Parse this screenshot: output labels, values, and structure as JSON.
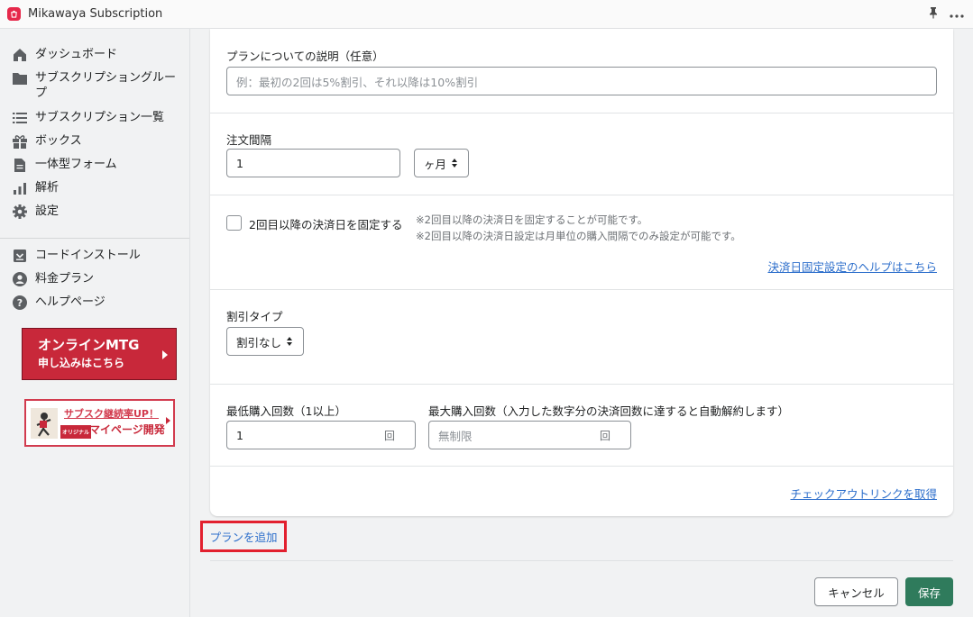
{
  "app": {
    "title": "Mikawaya Subscription"
  },
  "sidebar": {
    "items": [
      {
        "label": "ダッシュボード",
        "icon": "home-icon"
      },
      {
        "label": "サブスクリプショングループ",
        "icon": "folder-icon"
      },
      {
        "label": "サブスクリプション一覧",
        "icon": "list-icon"
      },
      {
        "label": "ボックス",
        "icon": "gift-icon"
      },
      {
        "label": "一体型フォーム",
        "icon": "document-icon"
      },
      {
        "label": "解析",
        "icon": "bar-chart-icon"
      },
      {
        "label": "設定",
        "icon": "gear-icon"
      }
    ],
    "items2": [
      {
        "label": "コードインストール",
        "icon": "code-install-icon"
      },
      {
        "label": "料金プラン",
        "icon": "user-icon"
      },
      {
        "label": "ヘルプページ",
        "icon": "help-icon"
      }
    ],
    "banner1": {
      "title": "オンラインMTG",
      "subtitle": "申し込みはこちら"
    },
    "banner2": {
      "title": "サブスク継続率UP！",
      "tag": "オリジナル",
      "subtitle": "マイページ開発"
    }
  },
  "form": {
    "description": {
      "label": "プランについての説明（任意）",
      "placeholder": "例：最初の2回は5%割引、それ以降は10%割引"
    },
    "interval": {
      "label": "注文間隔",
      "value": "1",
      "unit": "ヶ月"
    },
    "fixed_date": {
      "label": "2回目以降の決済日を固定する",
      "note1": "※2回目以降の決済日を固定することが可能です。",
      "note2": "※2回目以降の決済日設定は月単位の購入間隔でのみ設定が可能です。",
      "help_link": "決済日固定設定のヘルプはこちら"
    },
    "discount": {
      "label": "割引タイプ",
      "value": "割引なし"
    },
    "min_purchase": {
      "label": "最低購入回数（1以上）",
      "value": "1",
      "suffix": "回"
    },
    "max_purchase": {
      "label": "最大購入回数（入力した数字分の決済回数に達すると自動解約します）",
      "placeholder": "無制限",
      "suffix": "回"
    },
    "checkout_link": "チェックアウトリンクを取得"
  },
  "actions": {
    "add_plan": "プランを追加",
    "cancel": "キャンセル",
    "save": "保存"
  }
}
